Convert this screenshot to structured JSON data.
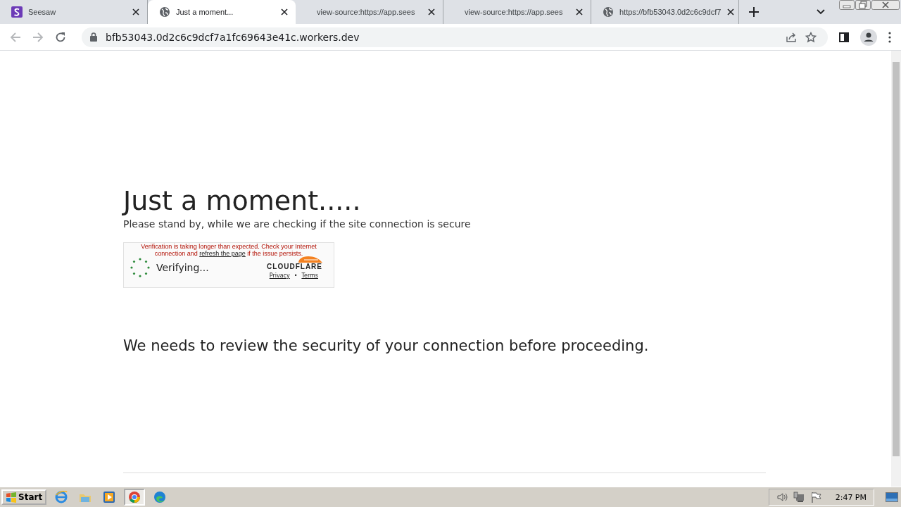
{
  "tabs": [
    {
      "title": "Seesaw",
      "kind": "seesaw",
      "selected": false
    },
    {
      "title": "Just a moment...",
      "kind": "globe",
      "selected": true
    },
    {
      "title": "view-source:https://app.sees",
      "kind": "plain",
      "selected": false
    },
    {
      "title": "view-source:https://app.sees",
      "kind": "plain",
      "selected": false
    },
    {
      "title": "https://bfb53043.0d2c6c9dcf7",
      "kind": "globe",
      "selected": false
    }
  ],
  "address_bar": {
    "url": "bfb53043.0d2c6c9dcf7a1fc69643e41c.workers.dev"
  },
  "page": {
    "heading": "Just a moment.....",
    "subheading": "Please stand by, while we are checking if the site connection is secure",
    "challenge": {
      "message_before": "Verification is taking longer than expected. Check your Internet connection and",
      "message_link": "refresh the page",
      "message_after": "if the issue persists.",
      "status": "Verifying...",
      "brand": "CLOUDFLARE",
      "links": [
        "Privacy",
        "Terms"
      ],
      "separator": "•"
    },
    "notice": "We needs to review the security of your connection before proceeding."
  },
  "taskbar": {
    "start": "Start",
    "apps": [
      {
        "kind": "ie",
        "selected": false
      },
      {
        "kind": "folder",
        "selected": false
      },
      {
        "kind": "media",
        "selected": false
      },
      {
        "kind": "chrome",
        "selected": true
      },
      {
        "kind": "edge",
        "selected": false
      }
    ],
    "clock": "2:47 PM"
  }
}
